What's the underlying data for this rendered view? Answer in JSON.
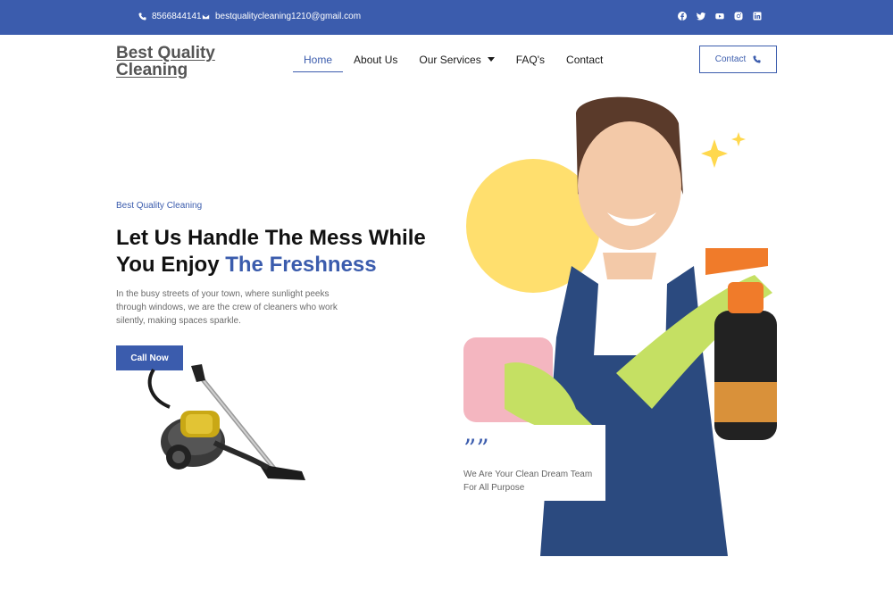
{
  "topbar": {
    "phone": "8566844141",
    "email": "bestqualitycleaning1210@gmail.com",
    "socials": [
      "facebook-icon",
      "twitter-icon",
      "youtube-icon",
      "instagram-icon",
      "linkedin-icon"
    ]
  },
  "header": {
    "logo_line1": "Best Quality",
    "logo_line2": "Cleaning",
    "nav": [
      "Home",
      "About Us",
      "Our Services",
      "FAQ's",
      "Contact"
    ],
    "contact_button": "Contact"
  },
  "hero": {
    "eyebrow": "Best Quality Cleaning",
    "headline_part1": "Let Us Handle The Mess While You Enjoy ",
    "headline_accent": "The Freshness",
    "description": "In the busy streets of your town, where sunlight peeks through windows, we are the crew of cleaners who work silently, making spaces sparkle.",
    "cta": "Call Now",
    "quote": "We Are Your Clean Dream Team For All Purpose"
  },
  "colors": {
    "brand": "#3b5cad",
    "accent_circle": "#ffdf6e",
    "glove": "#c5e063",
    "apron": "#2b4a7f"
  }
}
